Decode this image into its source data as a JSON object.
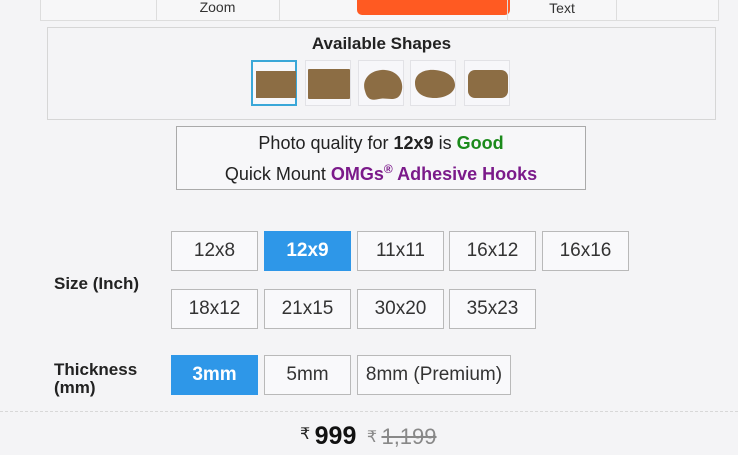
{
  "toolbar": {
    "zoom_label": "Zoom",
    "text_label": "Text",
    "accent": "#ff5a22"
  },
  "shapes": {
    "title": "Available Shapes",
    "items": [
      {
        "name": "rectangle",
        "selected": true
      },
      {
        "name": "square-rounded",
        "selected": false
      },
      {
        "name": "blob-1",
        "selected": false
      },
      {
        "name": "blob-2",
        "selected": false
      },
      {
        "name": "rounded-rectangle",
        "selected": false
      }
    ]
  },
  "quality": {
    "prefix": "Photo quality for ",
    "size": "12x9",
    "middle": " is ",
    "rating": "Good",
    "mount_prefix": "Quick Mount ",
    "brand": "OMGs",
    "reg": "®",
    "product": " Adhesive Hooks"
  },
  "size": {
    "label": "Size (Inch)",
    "options": [
      "12x8",
      "12x9",
      "11x11",
      "16x12",
      "16x16",
      "18x12",
      "21x15",
      "30x20",
      "35x23"
    ],
    "selected": "12x9"
  },
  "thickness": {
    "label_line1": "Thickness",
    "label_line2": "(mm)",
    "options": [
      "3mm",
      "5mm",
      "8mm (Premium)"
    ],
    "selected": "3mm"
  },
  "price": {
    "currency": "₹",
    "current": "999",
    "original": "1,199"
  },
  "colors": {
    "selected_option": "#2e97e8",
    "good": "#1b8a1b",
    "brand": "#7b1a8a",
    "shape_fill": "#8c6d44"
  }
}
